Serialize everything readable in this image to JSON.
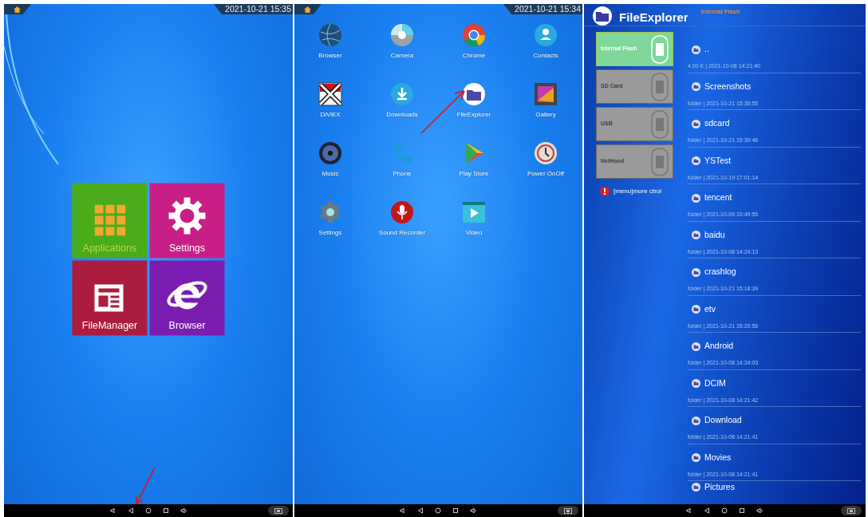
{
  "screens": [
    {
      "kind": "home",
      "status": {
        "time": "2021-10-21 15:35"
      },
      "tiles": [
        {
          "label": "Applications",
          "color": "#4aac1a"
        },
        {
          "label": "Settings",
          "color": "#c81f86"
        },
        {
          "label": "FileManager",
          "color": "#ac1c3e"
        },
        {
          "label": "Browser",
          "color": "#7a1db0"
        }
      ]
    },
    {
      "kind": "apps",
      "status": {
        "time": "2021-10-21 15:34"
      },
      "apps": [
        {
          "label": "Browser"
        },
        {
          "label": "Camera"
        },
        {
          "label": "Chrome"
        },
        {
          "label": "Contacts"
        },
        {
          "label": "DiViEX"
        },
        {
          "label": "Downloads"
        },
        {
          "label": "FileExplorer"
        },
        {
          "label": "Gallery"
        },
        {
          "label": "Music"
        },
        {
          "label": "Phone"
        },
        {
          "label": "Play Store"
        },
        {
          "label": "Power OnOff"
        },
        {
          "label": "Settings"
        },
        {
          "label": "Sound Recorder"
        },
        {
          "label": "Video"
        }
      ]
    },
    {
      "kind": "explorer",
      "title": "FileExplorer",
      "path": "Internal Flash",
      "devices": [
        {
          "label": "Internal Flash",
          "selected": true
        },
        {
          "label": "SD Card",
          "selected": false
        },
        {
          "label": "USB",
          "selected": false
        },
        {
          "label": "NetHood",
          "selected": false
        }
      ],
      "hint": "[menu]more ctrol",
      "entries": [
        {
          "name": "..",
          "meta": "4.00 K | 2021-10-08 14:21:40"
        },
        {
          "name": "Screenshots",
          "meta": "folder | 2021-10-21 15:35:55"
        },
        {
          "name": "sdcard",
          "meta": "folder | 2021-10-21 15:30:46"
        },
        {
          "name": "YSTest",
          "meta": "folder | 2021-10-19 17:01:14"
        },
        {
          "name": "tencent",
          "meta": "folder | 2021-10-09 10:49:55"
        },
        {
          "name": "baidu",
          "meta": "folder | 2021-10-08 14:24:13"
        },
        {
          "name": "crashlog",
          "meta": "folder | 2021-10-21 15:18:39"
        },
        {
          "name": "etv",
          "meta": "folder | 2021-10-21 15:20:56"
        },
        {
          "name": "Android",
          "meta": "folder | 2021-10-08 14:24:03"
        },
        {
          "name": "DCIM",
          "meta": "folder | 2021-10-08 14:21:42"
        },
        {
          "name": "Download",
          "meta": "folder | 2021-10-08 14:21:41"
        },
        {
          "name": "Movies",
          "meta": "folder | 2021-10-08 14:21:41"
        },
        {
          "name": "Pictures"
        }
      ]
    }
  ]
}
